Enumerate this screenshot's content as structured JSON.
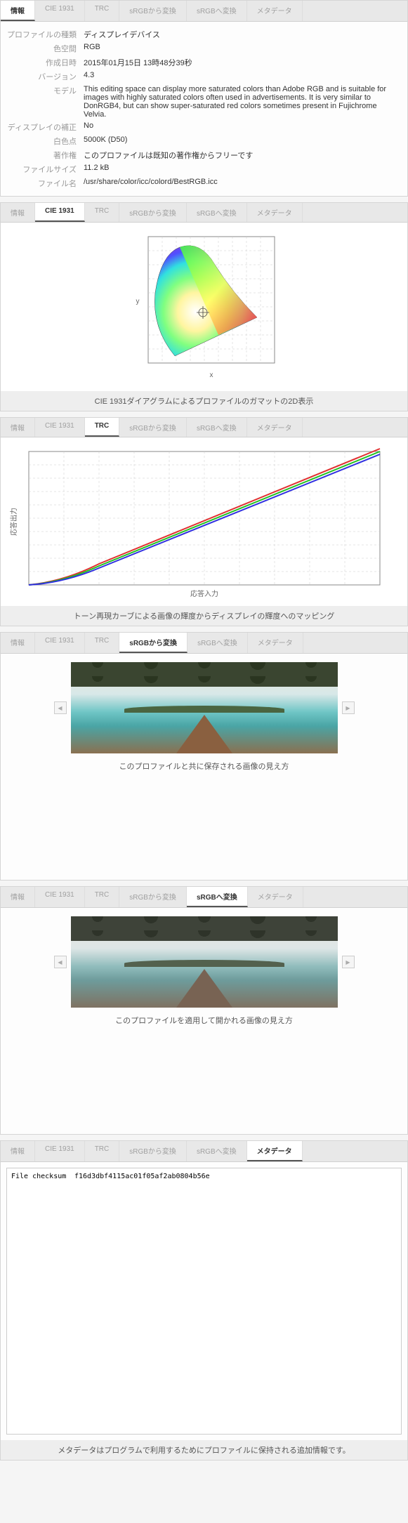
{
  "tabs": {
    "info": "情報",
    "cie": "CIE 1931",
    "trc": "TRC",
    "from_srgb": "sRGBから変換",
    "to_srgb": "sRGBへ変換",
    "metadata": "メタデータ"
  },
  "info": {
    "profile_type_label": "プロファイルの種類",
    "profile_type": "ディスプレイデバイス",
    "colorspace_label": "色空間",
    "colorspace": "RGB",
    "created_label": "作成日時",
    "created": "2015年01月15日 13時48分39秒",
    "version_label": "バージョン",
    "version": "4.3",
    "model_label": "モデル",
    "model": "This editing space can display more saturated colors than Adobe RGB and is suitable for images with highly saturated colors often used in advertisements. It is very similar to DonRGB4, but can show super-saturated red colors sometimes present in Fujichrome Velvia.",
    "display_corr_label": "ディスプレイの補正",
    "display_corr": "No",
    "whitepoint_label": "白色点",
    "whitepoint": "5000K (D50)",
    "copyright_label": "著作権",
    "copyright": "このプロファイルは既知の著作権からフリーです",
    "filesize_label": "ファイルサイズ",
    "filesize": "11.2 kB",
    "filename_label": "ファイル名",
    "filename": "/usr/share/color/icc/colord/BestRGB.icc"
  },
  "cie": {
    "caption": "CIE 1931ダイアグラムによるプロファイルのガマットの2D表示",
    "xlabel": "x",
    "ylabel": "y"
  },
  "trc": {
    "xlabel": "応答入力",
    "ylabel": "応答出力",
    "caption": "トーン再現カーブによる画像の輝度からディスプレイの輝度へのマッピング"
  },
  "from_srgb": {
    "caption": "このプロファイルと共に保存される画像の見え方"
  },
  "to_srgb": {
    "caption": "このプロファイルを適用して開かれる画像の見え方"
  },
  "metadata": {
    "rows": [
      {
        "key": "File checksum",
        "value": "f16d3dbf4115ac01f05af2ab0804b56e"
      }
    ],
    "footer": "メタデータはプログラムで利用するためにプロファイルに保持される追加情報です。"
  },
  "chart_data": [
    {
      "type": "area",
      "title": "CIE 1931 chromaticity diagram",
      "xlabel": "x",
      "ylabel": "y",
      "xlim": [
        0,
        0.8
      ],
      "ylim": [
        0,
        0.9
      ],
      "description": "Spectral locus horseshoe with chromaticity gradient fill; crosshair marker near D50 whitepoint at approx (0.345, 0.358)."
    },
    {
      "type": "line",
      "title": "Tone Reproduction Curve",
      "xlabel": "応答入力",
      "ylabel": "応答出力",
      "xlim": [
        0,
        1
      ],
      "ylim": [
        0,
        1
      ],
      "series": [
        {
          "name": "Red",
          "color": "#e03030",
          "values": [
            [
              0,
              0
            ],
            [
              0.1,
              0.04
            ],
            [
              0.3,
              0.24
            ],
            [
              0.5,
              0.48
            ],
            [
              0.7,
              0.72
            ],
            [
              0.9,
              0.92
            ],
            [
              1,
              1
            ]
          ]
        },
        {
          "name": "Green",
          "color": "#20c020",
          "values": [
            [
              0,
              0
            ],
            [
              0.1,
              0.035
            ],
            [
              0.3,
              0.22
            ],
            [
              0.5,
              0.46
            ],
            [
              0.7,
              0.7
            ],
            [
              0.9,
              0.91
            ],
            [
              1,
              1
            ]
          ]
        },
        {
          "name": "Blue",
          "color": "#3030e0",
          "values": [
            [
              0,
              0
            ],
            [
              0.1,
              0.03
            ],
            [
              0.3,
              0.2
            ],
            [
              0.5,
              0.44
            ],
            [
              0.7,
              0.68
            ],
            [
              0.9,
              0.9
            ],
            [
              1,
              1
            ]
          ]
        }
      ]
    }
  ]
}
